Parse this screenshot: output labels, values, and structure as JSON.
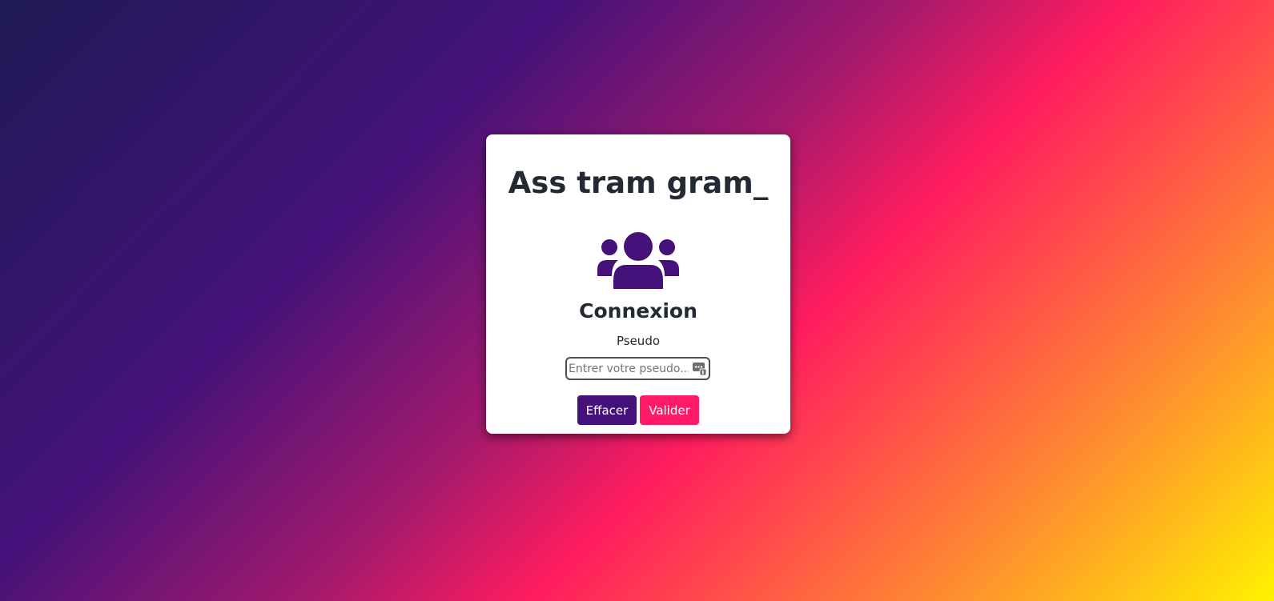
{
  "background": {
    "gradient_colors": [
      "#1f1a55",
      "#44127a",
      "#a2196d",
      "#ff1b5f",
      "#ff8b31",
      "#fff200"
    ]
  },
  "login_card": {
    "app_title": "Ass tram gram_",
    "users_icon": {
      "icon": "users-group-icon",
      "color": "#44107a"
    },
    "heading": "Connexion",
    "pseudo_field": {
      "label": "Pseudo",
      "placeholder": "Entrer votre pseudo...",
      "value": "",
      "autofill_icon": "autofill-key-icon"
    },
    "buttons": {
      "clear_label": "Effacer",
      "clear_color": "#44107a",
      "submit_label": "Valider",
      "submit_color": "#ff1b6a"
    }
  }
}
